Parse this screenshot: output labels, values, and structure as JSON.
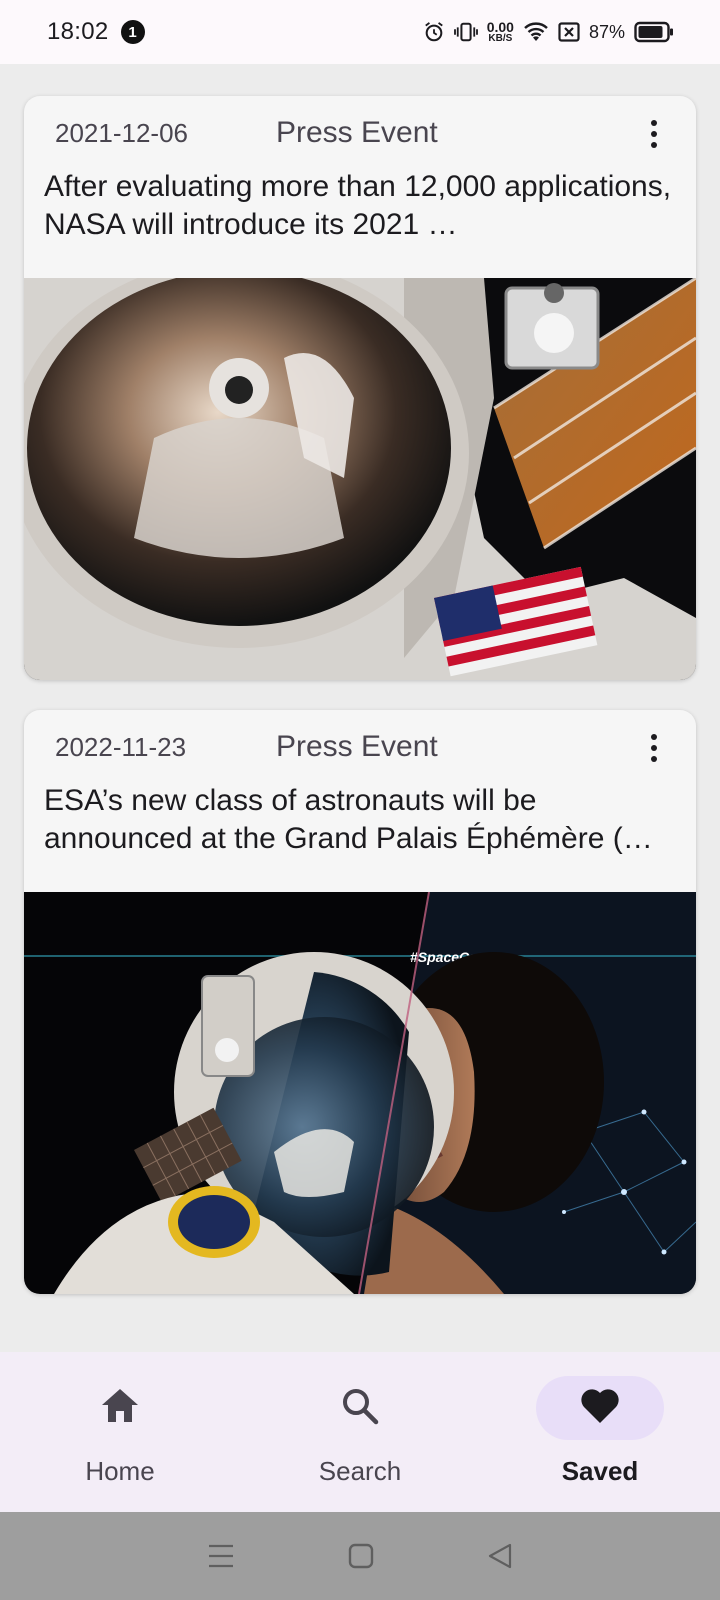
{
  "status_bar": {
    "time": "18:02",
    "notification_count": "1",
    "net_speed_value": "0.00",
    "net_speed_unit": "KB/S",
    "battery_percent": "87%"
  },
  "articles": [
    {
      "date": "2021-12-06",
      "type": "Press Event",
      "title": "After evaluating more than 12,000 applications, NASA will introduce its 2021 …",
      "image": "astronaut-spacewalk-helmet-reflection"
    },
    {
      "date": "2022-11-23",
      "type": "Press Event",
      "title": "ESA’s new class of astronauts will be announced at the Grand Palais Éphémère (…",
      "image": "astronaut-and-woman-split-portrait",
      "image_caption": "#SpaceCare"
    }
  ],
  "bottom_nav": {
    "items": [
      {
        "label": "Home",
        "icon": "home-icon",
        "active": false
      },
      {
        "label": "Search",
        "icon": "search-icon",
        "active": false
      },
      {
        "label": "Saved",
        "icon": "heart-icon",
        "active": true
      }
    ]
  },
  "colors": {
    "nav_background": "#f3edf7",
    "nav_active_pill": "#e8def8",
    "card_background": "#f6f6f6",
    "page_background": "#ececec"
  }
}
